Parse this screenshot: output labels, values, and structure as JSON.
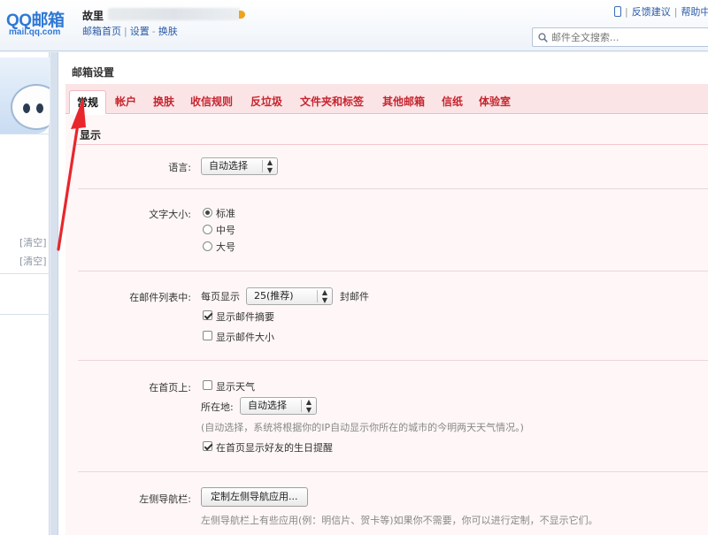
{
  "header": {
    "logo_text": "QQ邮箱",
    "logo_domain": "mail.qq.com",
    "user_name": "故里",
    "links": [
      "邮箱首页",
      "设置",
      "换肤"
    ],
    "right_links": [
      "反馈建议",
      "帮助中"
    ],
    "search_placeholder": "邮件全文搜索..."
  },
  "sidebar": {
    "clear_links": [
      "[清空]",
      "[清空]"
    ]
  },
  "main": {
    "page_title": "邮箱设置",
    "tabs": [
      "常规",
      "帐户",
      "换肤",
      "收信规则",
      "反垃圾",
      "文件夹和标签",
      "其他邮箱",
      "信纸",
      "体验室"
    ],
    "active_tab": "常规",
    "section_title": "显示"
  },
  "settings": {
    "language": {
      "label": "语言:",
      "value": "自动选择"
    },
    "font_size": {
      "label": "文字大小:",
      "options": [
        "标准",
        "中号",
        "大号"
      ],
      "selected": "标准"
    },
    "mail_list": {
      "label": "在邮件列表中:",
      "per_page_prefix": "每页显示",
      "per_page_value": "25(推荐)",
      "per_page_suffix": "封邮件",
      "show_summary": "显示邮件摘要",
      "show_summary_checked": true,
      "show_size": "显示邮件大小",
      "show_size_checked": false
    },
    "homepage": {
      "label": "在首页上:",
      "show_weather": "显示天气",
      "show_weather_checked": false,
      "location_label": "所在地:",
      "location_value": "自动选择",
      "location_hint": "(自动选择，系统将根据你的IP自动显示你所在的城市的今明两天天气情况。)",
      "birthday_reminder": "在首页显示好友的生日提醒",
      "birthday_reminder_checked": true
    },
    "left_nav": {
      "label": "左侧导航栏:",
      "button": "定制左侧导航应用...",
      "hint": "左侧导航栏上有些应用(例：明信片、贺卡等)如果你不需要，你可以进行定制，不显示它们。"
    }
  },
  "annotation": {
    "arrow_color": "#e8262c"
  }
}
